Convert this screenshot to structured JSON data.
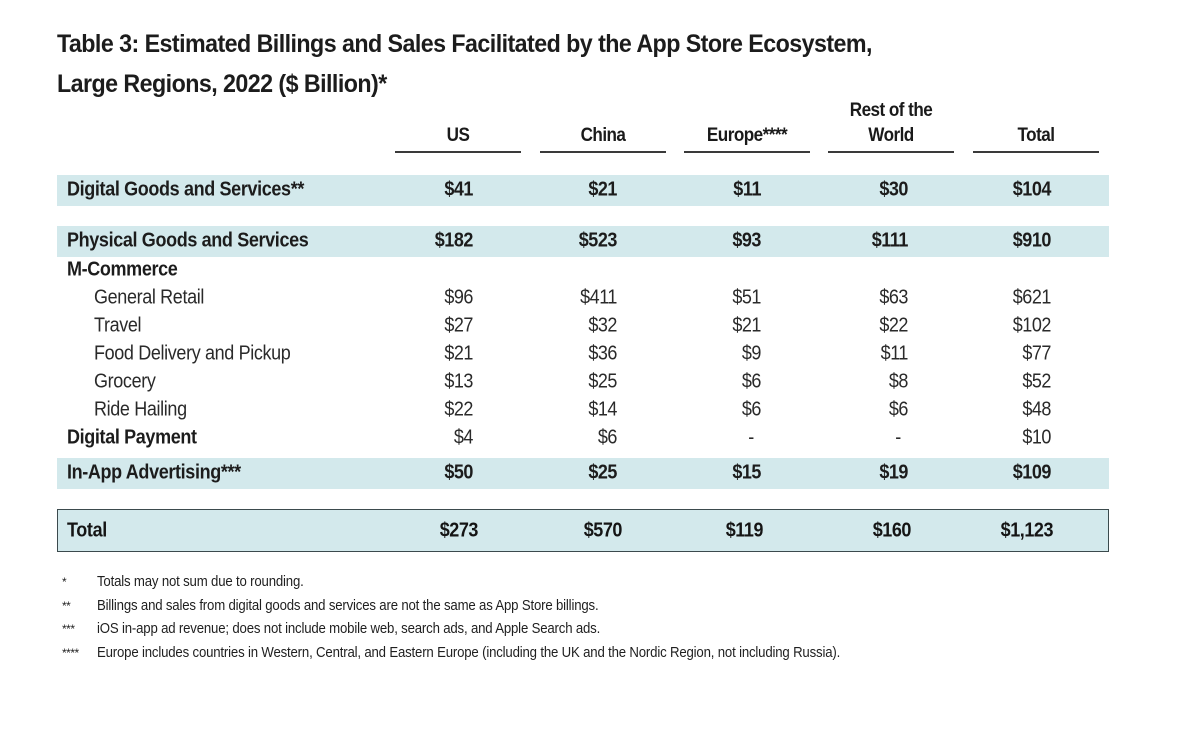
{
  "title": {
    "line1": "Table 3: Estimated Billings and Sales Facilitated by the App Store Ecosystem,",
    "line2": "Large Regions, 2022 ($ Billion)*"
  },
  "columns": [
    "US",
    "China",
    "Europe****",
    "Rest of the World",
    "Total"
  ],
  "columns_display": {
    "us": "US",
    "china": "China",
    "europe": "Europe****",
    "rest_line1": "Rest of the",
    "rest_line2": "World",
    "total": "Total"
  },
  "colors": {
    "band": "#d3e9ec",
    "rule": "#3a3a3a",
    "text": "#1c1c1c"
  },
  "rows": [
    {
      "label": "Digital Goods and Services**",
      "style": "band-bold",
      "values": [
        "$41",
        "$21",
        "$11",
        "$30",
        "$104"
      ]
    },
    {
      "label": "Physical Goods and Services",
      "style": "band-bold",
      "values": [
        "$182",
        "$523",
        "$93",
        "$111",
        "$910"
      ]
    },
    {
      "label": "M-Commerce",
      "style": "subhead",
      "values": [
        "",
        "",
        "",
        "",
        ""
      ]
    },
    {
      "label": "General Retail",
      "style": "indent",
      "values": [
        "$96",
        "$411",
        "$51",
        "$63",
        "$621"
      ]
    },
    {
      "label": "Travel",
      "style": "indent",
      "values": [
        "$27",
        "$32",
        "$21",
        "$22",
        "$102"
      ]
    },
    {
      "label": "Food Delivery and Pickup",
      "style": "indent",
      "values": [
        "$21",
        "$36",
        "$9",
        "$11",
        "$77"
      ]
    },
    {
      "label": "Grocery",
      "style": "indent",
      "values": [
        "$13",
        "$25",
        "$6",
        "$8",
        "$52"
      ]
    },
    {
      "label": "Ride Hailing",
      "style": "indent",
      "values": [
        "$22",
        "$14",
        "$6",
        "$6",
        "$48"
      ]
    },
    {
      "label": "Digital Payment",
      "style": "subhead-values",
      "values": [
        "$4",
        "$6",
        "-",
        "-",
        "$10"
      ]
    },
    {
      "label": "In-App Advertising***",
      "style": "band-bold",
      "values": [
        "$50",
        "$25",
        "$15",
        "$19",
        "$109"
      ]
    }
  ],
  "total_row": {
    "label": "Total",
    "values": [
      "$273",
      "$570",
      "$119",
      "$160",
      "$1,123"
    ]
  },
  "footnotes": [
    {
      "mark": "*",
      "text": "Totals may not sum due to rounding."
    },
    {
      "mark": "**",
      "text": "Billings and sales from digital goods and services are not the same as App Store billings."
    },
    {
      "mark": "***",
      "text": "iOS in-app ad revenue; does not include mobile web, search ads, and Apple Search ads."
    },
    {
      "mark": "****",
      "text": "Europe includes countries in Western, Central, and Eastern Europe (including the UK and the Nordic Region, not including Russia)."
    }
  ],
  "chart_data": {
    "type": "table",
    "title": "Table 3: Estimated Billings and Sales Facilitated by the App Store Ecosystem, Large Regions, 2022 ($ Billion)*",
    "columns": [
      "",
      "US",
      "China",
      "Europe****",
      "Rest of the World",
      "Total"
    ],
    "rows": [
      [
        "Digital Goods and Services**",
        41,
        21,
        11,
        30,
        104
      ],
      [
        "Physical Goods and Services",
        182,
        523,
        93,
        111,
        910
      ],
      [
        "M-Commerce",
        null,
        null,
        null,
        null,
        null
      ],
      [
        "General Retail",
        96,
        411,
        51,
        63,
        621
      ],
      [
        "Travel",
        27,
        32,
        21,
        22,
        102
      ],
      [
        "Food Delivery and Pickup",
        21,
        36,
        9,
        11,
        77
      ],
      [
        "Grocery",
        13,
        25,
        6,
        8,
        52
      ],
      [
        "Ride Hailing",
        22,
        14,
        6,
        6,
        48
      ],
      [
        "Digital Payment",
        4,
        6,
        null,
        null,
        10
      ],
      [
        "In-App Advertising***",
        50,
        25,
        15,
        19,
        109
      ],
      [
        "Total",
        273,
        570,
        119,
        160,
        1123
      ]
    ],
    "unit": "$ Billion"
  }
}
